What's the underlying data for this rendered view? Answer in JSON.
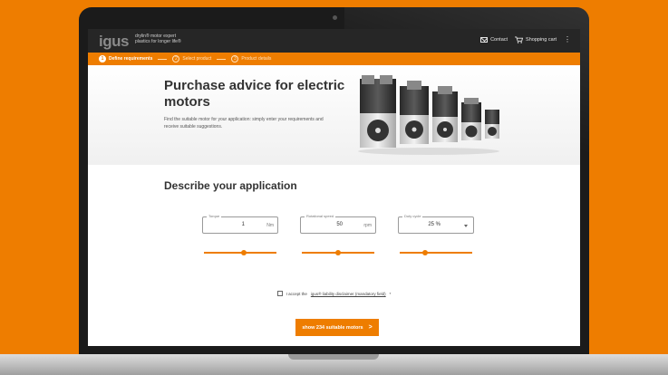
{
  "header": {
    "logo": "igus",
    "tagline_line1": "drylin® motor expert",
    "tagline_line2": "plastics for longer life®",
    "contact_label": "Contact",
    "cart_label": "Shopping cart",
    "menu_icon": "⋮"
  },
  "steps": [
    {
      "num": "1",
      "label": "Define requirements",
      "active": true
    },
    {
      "num": "2",
      "label": "Select product",
      "active": false
    },
    {
      "num": "3",
      "label": "Product details",
      "active": false
    }
  ],
  "hero": {
    "title": "Purchase advice for electric motors",
    "description": "Find the suitable motor for your application: simply enter your requirements and receive suitable suggestions."
  },
  "form": {
    "section_title": "Describe your application",
    "fields": [
      {
        "label": "Torque",
        "value": "1",
        "unit": "Nm",
        "slider_fraction": 0.55
      },
      {
        "label": "Rotational speed",
        "value": "50",
        "unit": "rpm",
        "slider_fraction": 0.5
      },
      {
        "label": "Duty cycle",
        "value": "25 %",
        "unit": "",
        "slider_fraction": 0.35
      }
    ],
    "consent_prefix": "I accept the",
    "consent_link": "igus® liability disclaimer (mandatory field)",
    "consent_suffix": "*",
    "cta_label": "show 234 suitable motors",
    "cta_icon": ">"
  },
  "colors": {
    "accent": "#ee7d00",
    "header_bg": "#262626"
  }
}
